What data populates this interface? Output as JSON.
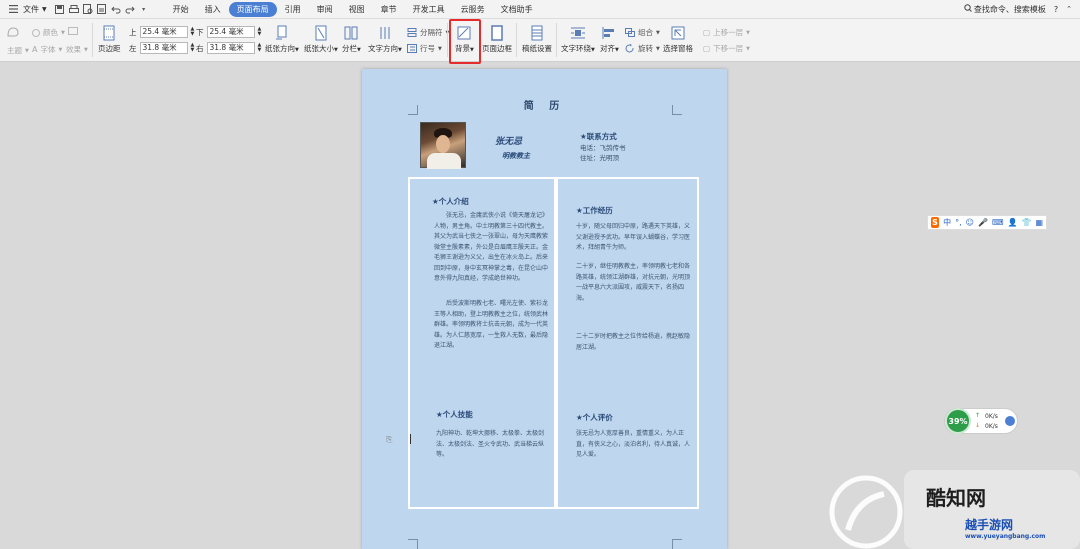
{
  "topbar": {
    "file_label": "文件",
    "tabs": [
      {
        "label": "开始",
        "active": false
      },
      {
        "label": "插入",
        "active": false
      },
      {
        "label": "页面布局",
        "active": true
      },
      {
        "label": "引用",
        "active": false
      },
      {
        "label": "审阅",
        "active": false
      },
      {
        "label": "视图",
        "active": false
      },
      {
        "label": "章节",
        "active": false
      },
      {
        "label": "开发工具",
        "active": false
      },
      {
        "label": "云服务",
        "active": false
      },
      {
        "label": "文档助手",
        "active": false
      }
    ],
    "search_label": "查找命令、搜索模板",
    "help_label": "?"
  },
  "ribbon": {
    "theme_label": "主题",
    "color_label": "颜色",
    "font_label": "字体",
    "effect_label": "效果",
    "margin_label": "页边距",
    "top_label": "上",
    "bottom_label": "下",
    "left_label": "左",
    "right_label": "右",
    "top_value": "25.4 毫米",
    "bottom_value": "25.4 毫米",
    "left_value": "31.8 毫米",
    "right_value": "31.8 毫米",
    "orientation_label": "纸张方向",
    "size_label": "纸张大小",
    "columns_label": "分栏",
    "text_direction_label": "文字方向",
    "break_label": "分隔符",
    "line_no_label": "行号",
    "background_label": "背景",
    "page_border_label": "页面边框",
    "draft_label": "稿纸设置",
    "wrap_label": "文字环绕",
    "align_label": "对齐",
    "group_label": "组合",
    "rotate_label": "旋转",
    "select_pane_label": "选择窗格",
    "up_label": "上移一层",
    "down_label": "下移一层",
    "accent_color": "#4a7fd4",
    "highlight_color": "#e52b2b"
  },
  "document": {
    "title": "简 历",
    "name": "张无忌",
    "role": "明教教主",
    "contact_heading": "★联系方式",
    "contact_phone": "电话：飞鸽传书",
    "contact_address": "住址：光明顶",
    "intro_heading": "★个人介绍",
    "intro_p1": "张无忌，金庸武侠小说《倚天屠龙记》人物，男主角。中土明教第三十四代教主。其父为武当七侠之一张翠山，母为天鹰教紫微堂主殷素素，外公是白眉鹰王殷天正。金毛狮王谢逊为义父，出生在冰火岛上。后来回到中原，身中玄冥神掌之毒，在昆仑山中意外得九阳真经，学成绝世神功。",
    "intro_p2": "后受波斯明教七老、曙光左使、紫衫龙王等人相助，登上明教教主之位，统领武林群雄。率领明教将士抗击元朝，成为一代英雄。为人仁慈宽厚，一生救人无数，最后隐退江湖。",
    "skills_heading": "★个人技能",
    "skills_p": "九阳神功、乾坤大挪移、太极拳、太极剑法、太极剑法、圣火令武功、武当梯云纵等。",
    "work_heading": "★工作经历",
    "work_p1": "十岁，随父母回归中原，路遇天下英雄，义父谢逊授予武功。早年误入蝴蝶谷，学习医术，拜胡青牛为师。",
    "work_p2": "二十岁，继任明教教主，率领明教七老和各路英雄，统领江湖群雄，对抗元朝，光明顶一战平息六大派围攻，威震天下，名扬四海。",
    "work_p3": "二十二岁时把教主之位传给杨逍，携赵敏隐居江湖。",
    "eval_heading": "★个人评价",
    "eval_p": "张无忌为人宽厚善良，重情重义，为人正直，有侠义之心，淡泊名利，待人真诚，人见人爱。"
  },
  "sogou": {
    "items": [
      "中",
      "°,",
      "☺",
      "🎤",
      "⌨",
      "👤",
      "👕",
      "▦"
    ]
  },
  "speed": {
    "percent": "39%",
    "up": "0K/s",
    "down": "0K/s"
  },
  "watermark": {
    "brand": "酷知网",
    "url": "www.yueyangbang.com",
    "slogan": "越手游网"
  }
}
